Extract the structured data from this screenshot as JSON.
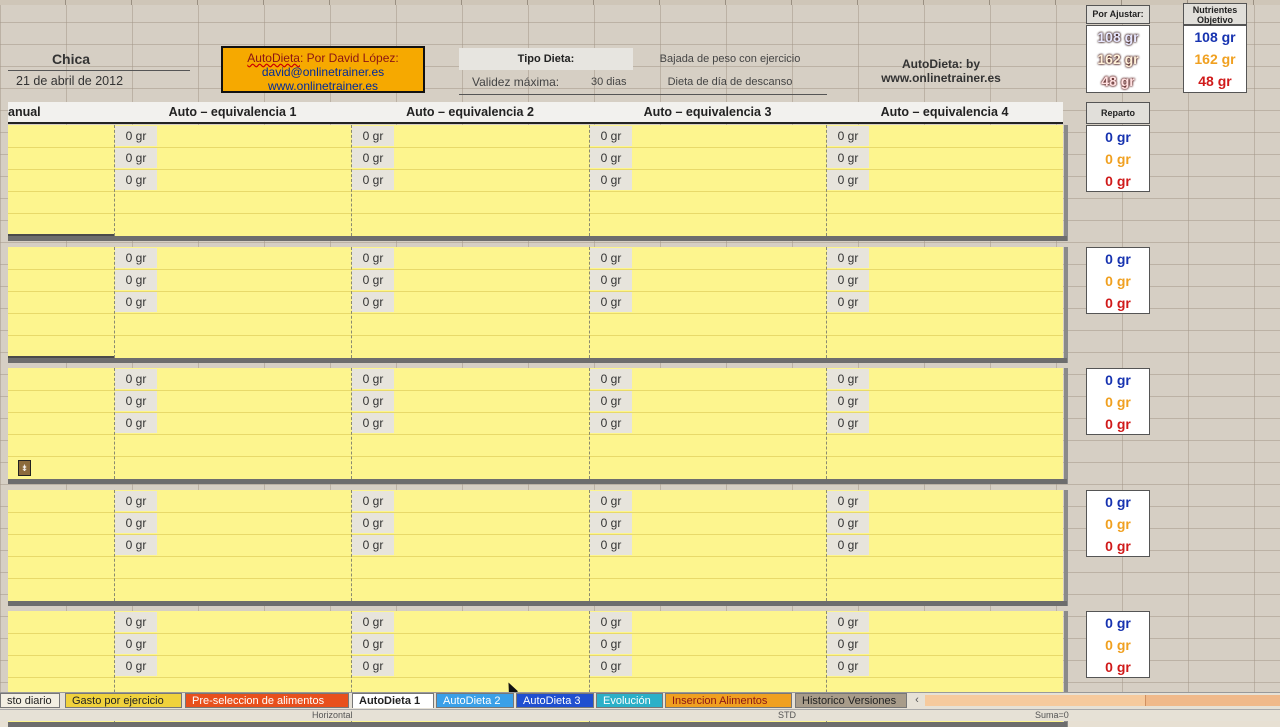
{
  "header": {
    "title": "Chica",
    "date": "21 de abril de 2012",
    "autodieta_box": {
      "line1_prefix": "AutoDieta",
      "line1_suffix": ": Por David López:",
      "email": "david@onlinetrainer.es",
      "web": "www.onlinetrainer.es"
    },
    "tipo_dieta_label": "Tipo Dieta:",
    "tipo_dieta_value": "Bajada de peso con ejercicio",
    "validez_label": "Validez máxima:",
    "validez_value": "30 dias",
    "dieta_dia": "Dieta de día de descanso",
    "brand_line1": "AutoDieta: by",
    "brand_line2": "www.onlinetrainer.es"
  },
  "por_ajustar": {
    "label": "Por Ajustar:",
    "values": [
      "108 gr",
      "162 gr",
      "48 gr"
    ]
  },
  "nutrientes": {
    "label_line1": "Nutrientes",
    "label_line2": "Objetivo",
    "values": [
      "108 gr",
      "162 gr",
      "48 gr"
    ]
  },
  "reparto": {
    "label": "Reparto"
  },
  "table": {
    "headers": [
      "anual",
      "Auto – equivalencia 1",
      "Auto – equivalencia 2",
      "Auto – equivalencia 3",
      "Auto – equivalencia 4"
    ],
    "cell_value": "0 gr",
    "blocks": [
      {
        "reparto": [
          "0 gr",
          "0 gr",
          "0 gr"
        ]
      },
      {
        "reparto": [
          "0 gr",
          "0 gr",
          "0 gr"
        ]
      },
      {
        "reparto": [
          "0 gr",
          "0 gr",
          "0 gr"
        ]
      },
      {
        "reparto": [
          "0 gr",
          "0 gr",
          "0 gr"
        ]
      },
      {
        "reparto": [
          "0 gr",
          "0 gr",
          "0 gr"
        ]
      }
    ]
  },
  "tabs": [
    {
      "label": "sto diario",
      "color": "#f3efe2"
    },
    {
      "label": "Gasto por ejercicio",
      "color": "#f0d23c"
    },
    {
      "label": "Pre-seleccion de alimentos",
      "color": "#e8501c"
    },
    {
      "label": "AutoDieta 1",
      "color": "#ffffff"
    },
    {
      "label": "AutoDieta 2",
      "color": "#3aa0e8"
    },
    {
      "label": "AutoDieta 3",
      "color": "#1f4fd0"
    },
    {
      "label": "Evolución",
      "color": "#2bb0c8"
    },
    {
      "label": "Insercion Alimentos",
      "color": "#f0a020"
    },
    {
      "label": "Historico Versiones",
      "color": "#a89c8a"
    }
  ],
  "status": {
    "left": "Horizontal",
    "std": "STD",
    "sum": "Suma=0"
  }
}
